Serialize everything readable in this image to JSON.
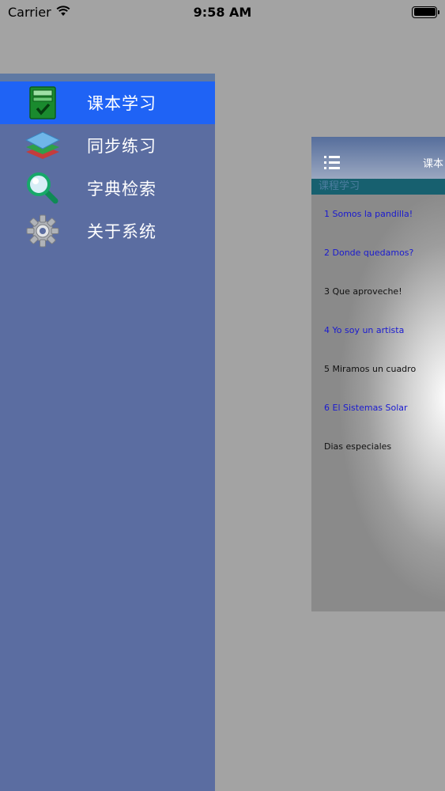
{
  "status_bar": {
    "carrier": "Carrier",
    "time": "9:58 AM"
  },
  "side_menu": {
    "items": [
      {
        "label": "课本学习",
        "icon": "textbook-check-icon",
        "selected": true
      },
      {
        "label": "同步练习",
        "icon": "layers-icon",
        "selected": false
      },
      {
        "label": "字典检索",
        "icon": "magnifier-icon",
        "selected": false
      },
      {
        "label": "关于系统",
        "icon": "gear-icon",
        "selected": false
      }
    ]
  },
  "main": {
    "nav_title": "课本",
    "section_header": "课程学习",
    "lessons": [
      {
        "label": "1 Somos la pandilla!",
        "color": "blue"
      },
      {
        "label": "2 Donde quedamos?",
        "color": "blue"
      },
      {
        "label": "3 Que aproveche!",
        "color": "dark"
      },
      {
        "label": "4 Yo soy un artista",
        "color": "blue"
      },
      {
        "label": "5 Miramos un cuadro",
        "color": "dark"
      },
      {
        "label": "6 El Sistemas Solar",
        "color": "blue"
      },
      {
        "label": "Dias especiales",
        "color": "dark"
      }
    ]
  },
  "colors": {
    "background": "#a3a3a3",
    "side_menu": "#5b6da1",
    "selected_item": "#1f63f5",
    "lesson_blue": "#1a1ad0",
    "section_header": "#17606f"
  }
}
